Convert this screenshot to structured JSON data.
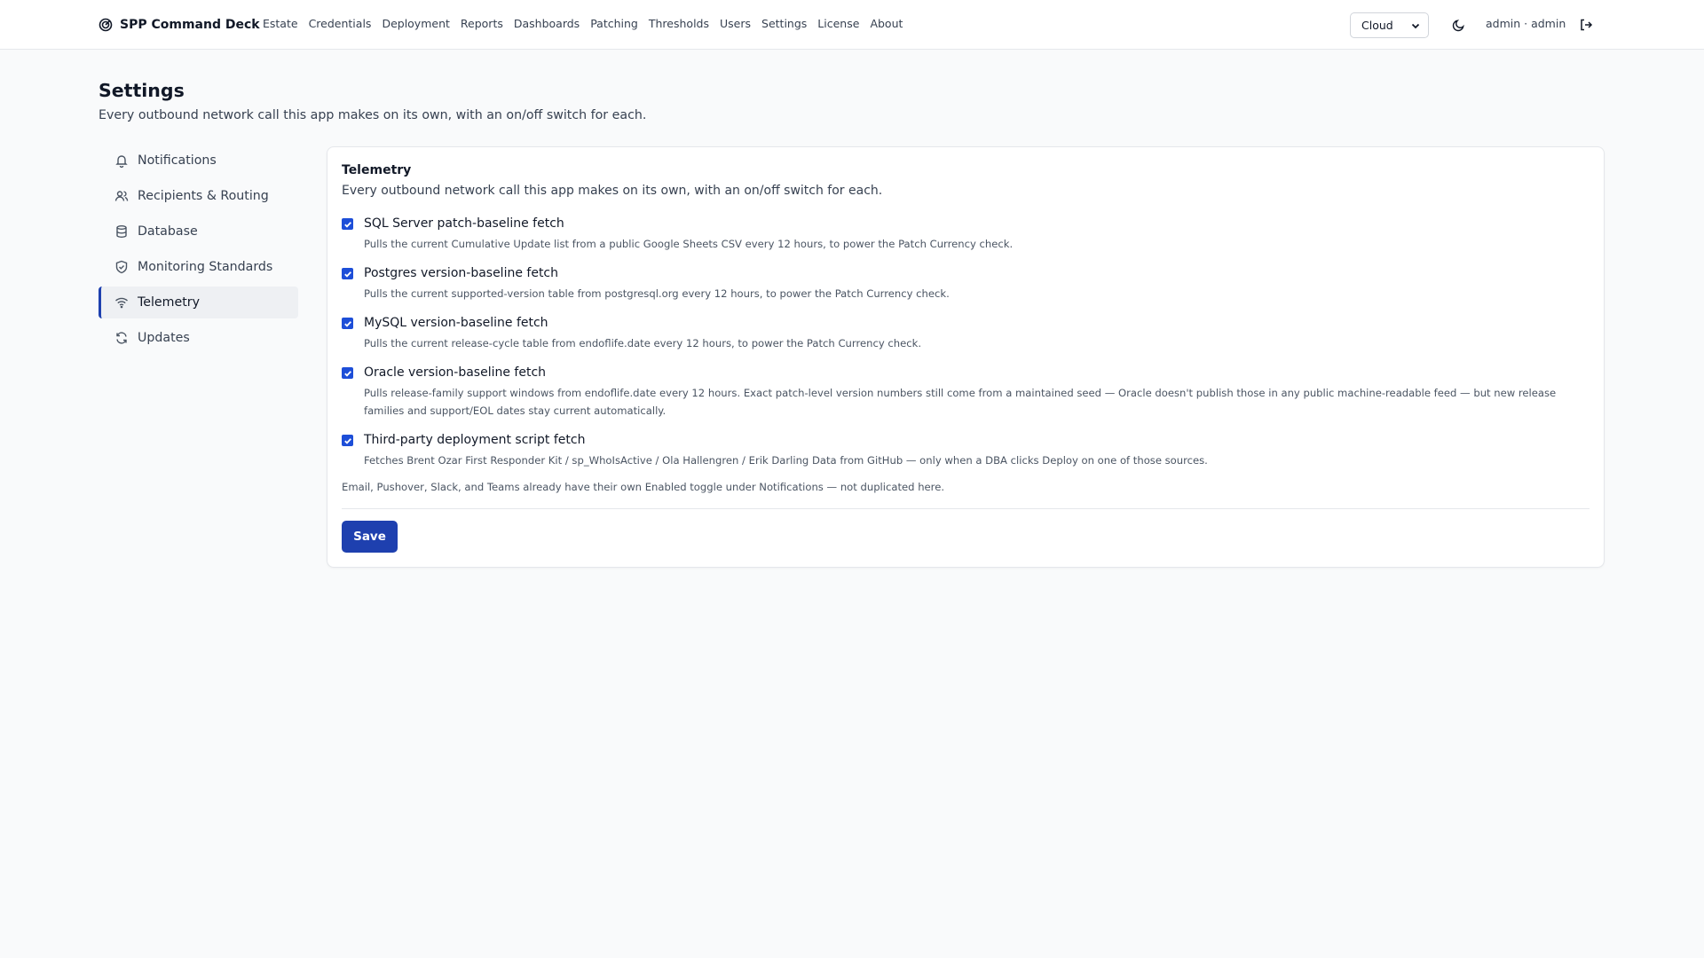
{
  "app": {
    "brand": "SPP Command Deck",
    "nav": [
      "Estate",
      "Credentials",
      "Deployment",
      "Reports",
      "Dashboards",
      "Patching",
      "Thresholds",
      "Users",
      "Settings",
      "License",
      "About"
    ],
    "environment": "Cloud",
    "user": "admin · admin"
  },
  "page": {
    "title": "Settings",
    "subtitle": "Every outbound network call this app makes on its own, with an on/off switch for each."
  },
  "sidebar": {
    "items": [
      {
        "label": "Notifications",
        "icon": "bell-icon",
        "active": false
      },
      {
        "label": "Recipients & Routing",
        "icon": "users-icon",
        "active": false
      },
      {
        "label": "Database",
        "icon": "database-icon",
        "active": false
      },
      {
        "label": "Monitoring Standards",
        "icon": "shield-check-icon",
        "active": false
      },
      {
        "label": "Telemetry",
        "icon": "wifi-icon",
        "active": true
      },
      {
        "label": "Updates",
        "icon": "refresh-icon",
        "active": false
      }
    ]
  },
  "telemetry": {
    "title": "Telemetry",
    "subtitle": "Every outbound network call this app makes on its own, with an on/off switch for each.",
    "options": [
      {
        "label": "SQL Server patch-baseline fetch",
        "checked": true,
        "description": "Pulls the current Cumulative Update list from a public Google Sheets CSV every 12 hours, to power the Patch Currency check."
      },
      {
        "label": "Postgres version-baseline fetch",
        "checked": true,
        "description": "Pulls the current supported-version table from postgresql.org every 12 hours, to power the Patch Currency check."
      },
      {
        "label": "MySQL version-baseline fetch",
        "checked": true,
        "description": "Pulls the current release-cycle table from endoflife.date every 12 hours, to power the Patch Currency check."
      },
      {
        "label": "Oracle version-baseline fetch",
        "checked": true,
        "description": "Pulls release-family support windows from endoflife.date every 12 hours. Exact patch-level version numbers still come from a maintained seed — Oracle doesn't publish those in any public machine-readable feed — but new release families and support/EOL dates stay current automatically."
      },
      {
        "label": "Third-party deployment script fetch",
        "checked": true,
        "description": "Fetches Brent Ozar First Responder Kit / sp_WhoIsActive / Ola Hallengren / Erik Darling Data from GitHub — only when a DBA clicks Deploy on one of those sources."
      }
    ],
    "note": "Email, Pushover, Slack, and Teams already have their own Enabled toggle under Notifications — not duplicated here.",
    "save_label": "Save"
  },
  "colors": {
    "accent": "#1e40af",
    "checkbox": "#1d4ed8",
    "background": "#f9fafb"
  }
}
